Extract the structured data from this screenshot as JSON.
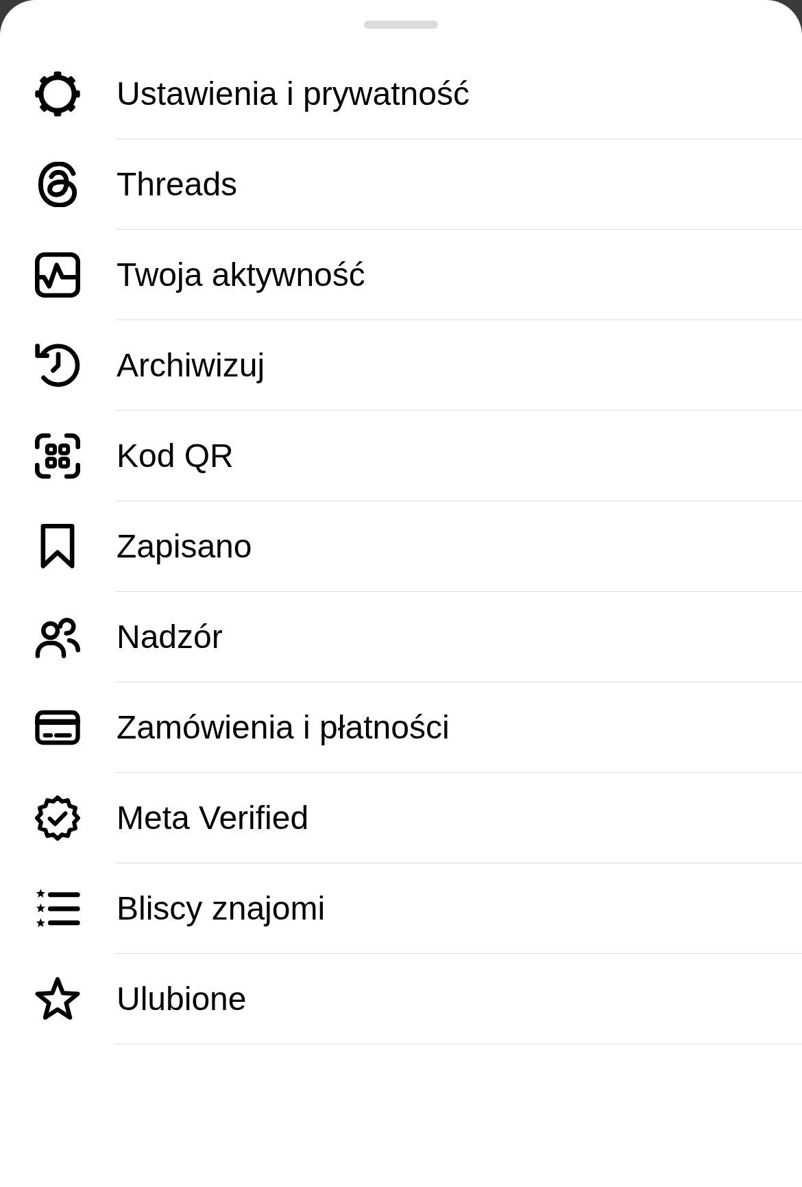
{
  "sheet": {
    "items": [
      {
        "kind": "settings",
        "label": "Ustawienia i prywatność"
      },
      {
        "kind": "threads",
        "label": "Threads"
      },
      {
        "kind": "activity",
        "label": "Twoja aktywność"
      },
      {
        "kind": "archive",
        "label": "Archiwizuj"
      },
      {
        "kind": "qr",
        "label": "Kod QR"
      },
      {
        "kind": "saved",
        "label": "Zapisano"
      },
      {
        "kind": "supervision",
        "label": "Nadzór"
      },
      {
        "kind": "payments",
        "label": "Zamówienia i płatności"
      },
      {
        "kind": "verified",
        "label": "Meta Verified"
      },
      {
        "kind": "friends",
        "label": "Bliscy znajomi"
      },
      {
        "kind": "favorites",
        "label": "Ulubione"
      }
    ]
  }
}
